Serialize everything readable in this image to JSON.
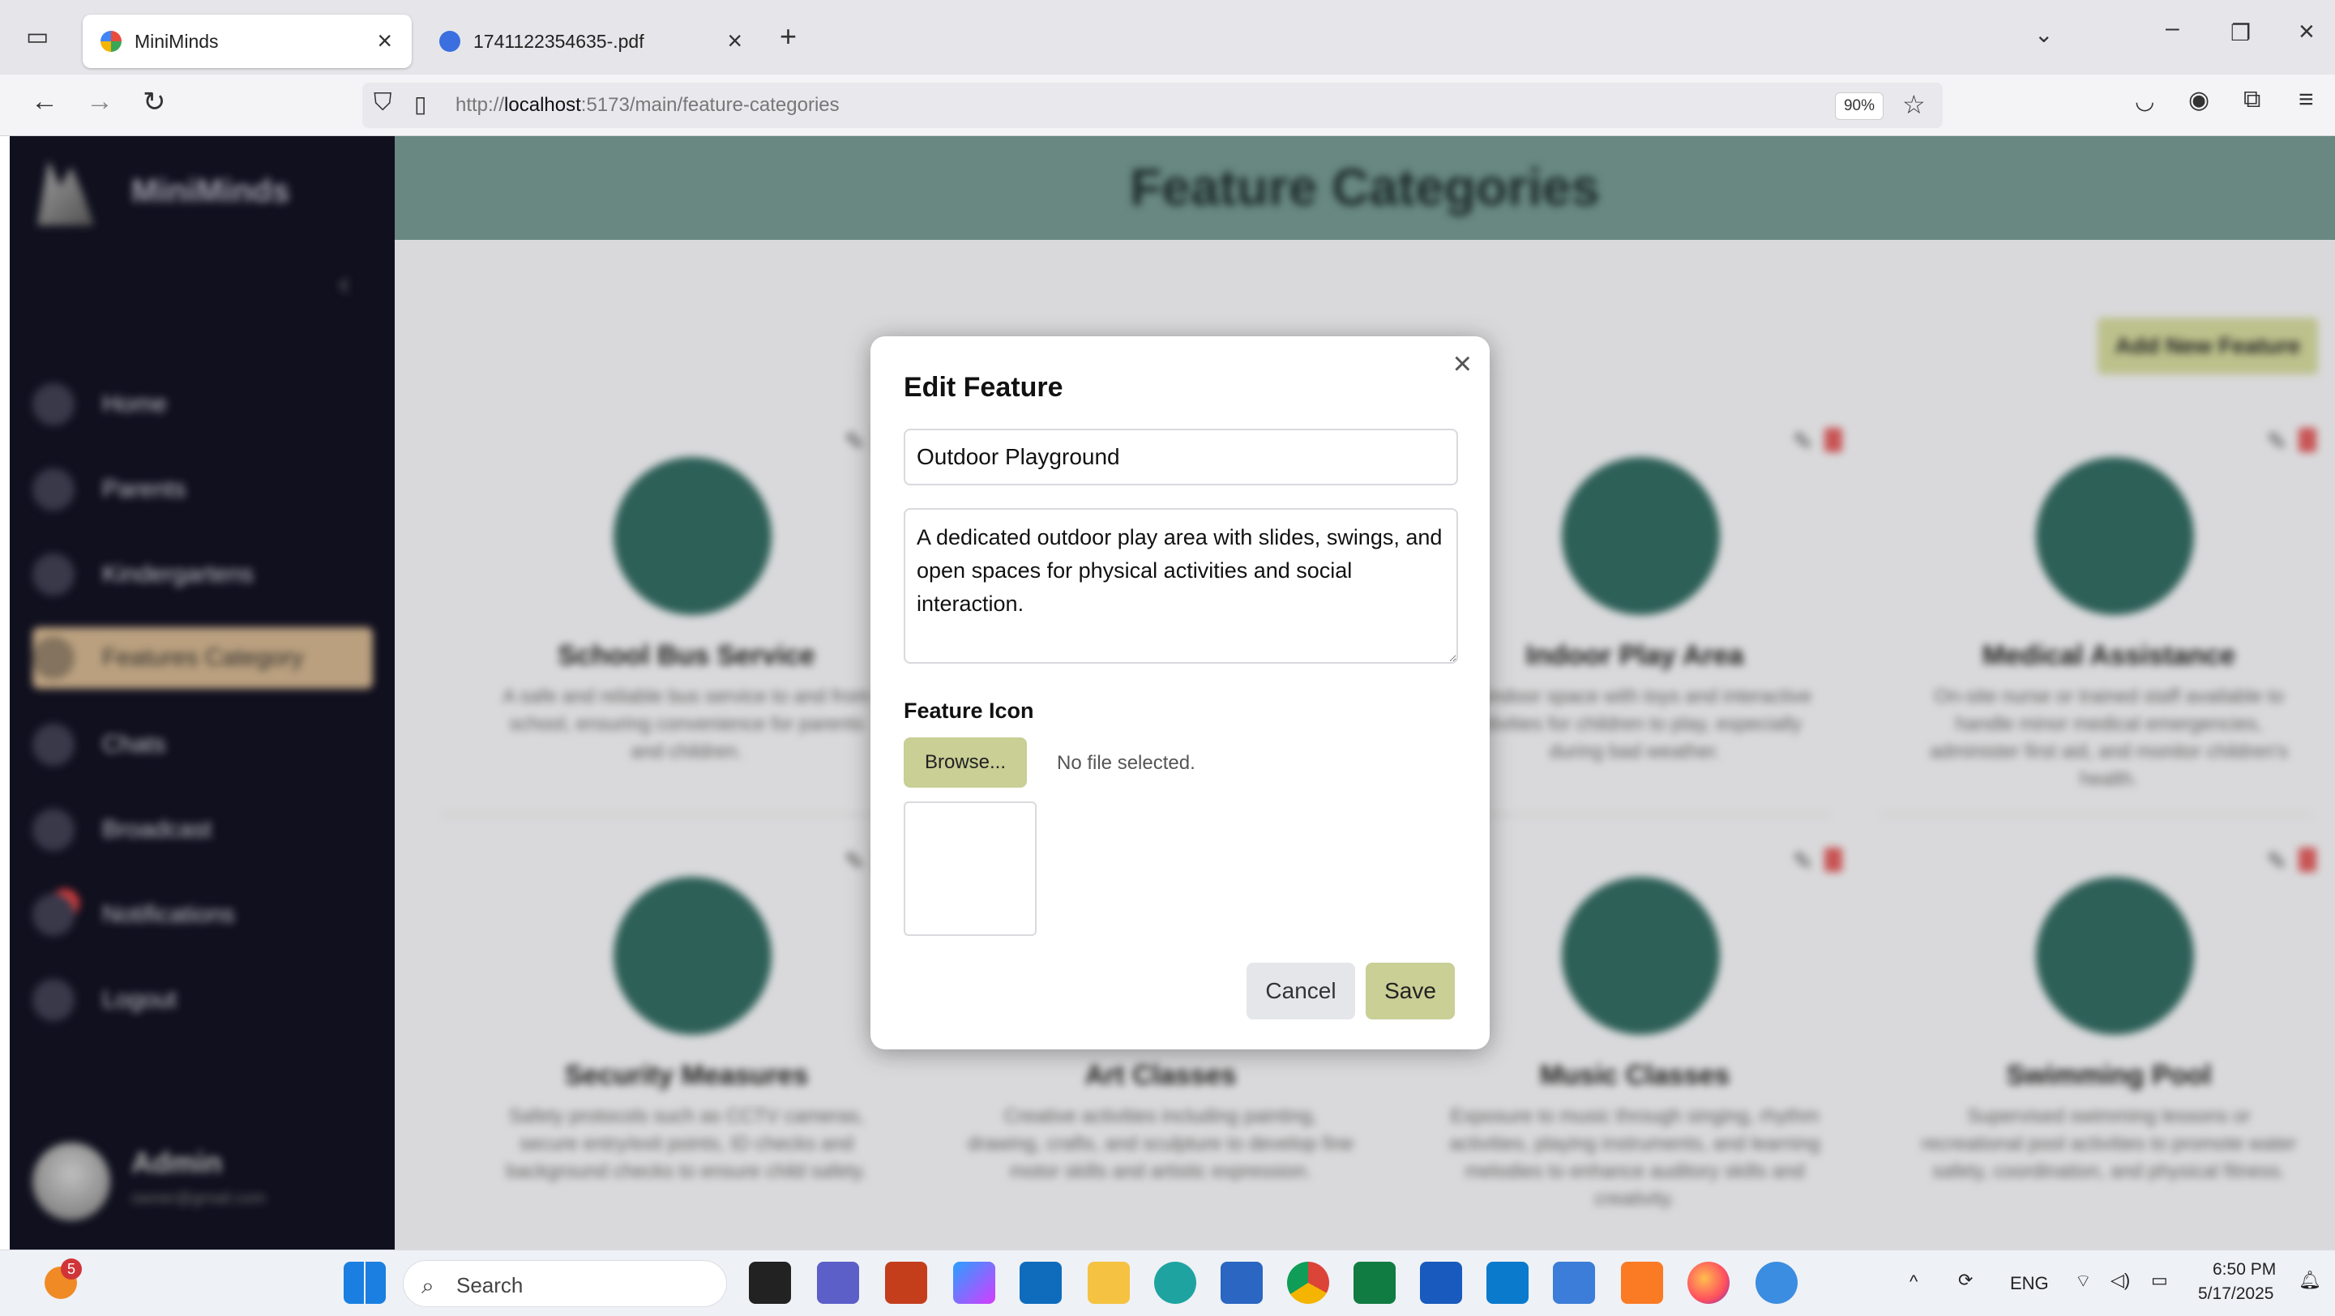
{
  "browser": {
    "tabs": [
      {
        "title": "MiniMinds",
        "active": true
      },
      {
        "title": "1741122354635-.pdf",
        "active": false
      }
    ],
    "new_tab": "+",
    "url_prefix": "http://",
    "url_host": "localhost",
    "url_rest": ":5173/main/feature-categories",
    "zoom": "90%"
  },
  "app": {
    "brand": "MiniMinds",
    "page_title": "Feature Categories",
    "add_button": "Add New Feature",
    "sidebar": {
      "items": [
        {
          "label": "Home"
        },
        {
          "label": "Parents"
        },
        {
          "label": "Kindergartens"
        },
        {
          "label": "Features Category",
          "active": true
        },
        {
          "label": "Chats"
        },
        {
          "label": "Broadcast"
        },
        {
          "label": "Notifications"
        },
        {
          "label": "Logout"
        }
      ],
      "user_name": "Admin",
      "user_email": "owner@gmail.com"
    },
    "cards": [
      {
        "title": "School Bus Service",
        "desc": "A safe and reliable bus service to and from school, ensuring convenience for parents and children."
      },
      {
        "title": "Indoor Play Area",
        "desc": "An indoor space with toys and interactive activities for children to play, especially during bad weather."
      },
      {
        "title": "Medical Assistance",
        "desc": "On-site nurse or trained staff available to handle minor medical emergencies, administer first aid, and monitor children's health."
      },
      {
        "title": "Security Measures",
        "desc": "Safety protocols such as CCTV cameras, secure entry/exit points, ID checks and background checks to ensure child safety."
      },
      {
        "title": "Art Classes",
        "desc": "Creative activities including painting, drawing, crafts, and sculpture to develop fine motor skills and artistic expression."
      },
      {
        "title": "Music Classes",
        "desc": "Exposure to music through singing, rhythm activities, playing instruments, and learning melodies to enhance auditory skills and creativity."
      },
      {
        "title": "Swimming Pool",
        "desc": "Supervised swimming lessons or recreational pool activities to promote water safety, coordination, and physical fitness."
      }
    ]
  },
  "modal": {
    "title": "Edit Feature",
    "close": "×",
    "name_value": "Outdoor Playground",
    "description_value": "A dedicated outdoor play area with slides, swings, and open spaces for physical activities and social interaction.",
    "icon_label": "Feature Icon",
    "browse_label": "Browse...",
    "no_file": "No file selected.",
    "cancel_label": "Cancel",
    "save_label": "Save"
  },
  "taskbar": {
    "search_label": "Search",
    "notification_count": "5",
    "lang": "ENG",
    "time": "6:50 PM",
    "date": "5/17/2025"
  },
  "colors": {
    "sidebar": "#0f0f1f",
    "header": "#6f918a",
    "accent_button": "#c9cf95",
    "card_circle": "#2e655c",
    "active_nav": "#c7ab87"
  }
}
